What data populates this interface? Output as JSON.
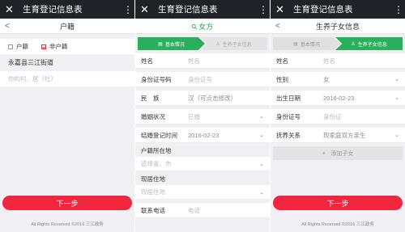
{
  "panel1": {
    "window_title": "生育登记信息表",
    "close_icon": "✕",
    "more_icon": "⋮",
    "back_icon": "<",
    "sub_title": "户籍",
    "options": [
      "户籍",
      "非户籍"
    ],
    "selected_option": "非户籍",
    "address_label": "永嘉县三江街道",
    "address_placeholder": "你的村、居（社）",
    "next_label": "下一步",
    "footer": "All Rights Reserved ©2016 三江政务"
  },
  "panel2": {
    "window_title": "生育登记信息表",
    "close_icon": "✕",
    "more_icon": "⋮",
    "sub_title": "女方",
    "step1": "基本情况",
    "step2": "生养子女信息",
    "fields": [
      {
        "label": "姓名",
        "value": "姓名"
      },
      {
        "label": "身份证号码",
        "value": "身份证号"
      },
      {
        "label": "民　族",
        "value": "汉（可点击修改）"
      },
      {
        "label": "婚姻状况",
        "value": "已婚"
      },
      {
        "label": "结婚登记时间",
        "value": "2016-02-23"
      }
    ],
    "huji_label": "户籍所在地",
    "huji_placeholder": "选择省、市",
    "xianzhu_label": "现居住地",
    "xianzhu_placeholder": "现居住地",
    "contact_label": "联系电话",
    "contact_placeholder": "电话"
  },
  "panel3": {
    "window_title": "生育登记信息表",
    "close_icon": "✕",
    "more_icon": "⋮",
    "back_icon": "<",
    "sub_title": "生养子女信息",
    "step1": "基本情况",
    "step2": "生养子女信息",
    "fields": [
      {
        "label": "姓名",
        "value": "姓名"
      },
      {
        "label": "性别",
        "value": "女"
      },
      {
        "label": "出生日期",
        "value": "2016-02-23"
      },
      {
        "label": "身份证号",
        "value": "身份证"
      },
      {
        "label": "抚养关系",
        "value": "现家庭双方亲生"
      }
    ],
    "add_child": "添加子女",
    "next_label": "下一步",
    "footer": "All Rights Reserved ©2016 三江政务"
  },
  "colors": {
    "topbar": "#1f2328",
    "accent_red": "#f0263e",
    "accent_green": "#28b05a"
  }
}
